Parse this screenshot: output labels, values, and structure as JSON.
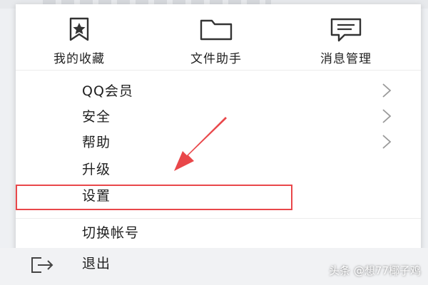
{
  "top_actions": [
    {
      "label": "我的收藏",
      "icon": "bookmark-star-icon"
    },
    {
      "label": "文件助手",
      "icon": "folder-icon"
    },
    {
      "label": "消息管理",
      "icon": "message-bubble-icon"
    }
  ],
  "menu_items": [
    {
      "label": "QQ会员",
      "has_submenu": true
    },
    {
      "label": "安全",
      "has_submenu": true
    },
    {
      "label": "帮助",
      "has_submenu": true
    },
    {
      "label": "升级",
      "has_submenu": false
    },
    {
      "label": "设置",
      "has_submenu": false,
      "highlighted": true
    }
  ],
  "account": {
    "switch_label": "切换帐号"
  },
  "exit": {
    "label": "退出",
    "icon": "exit-icon"
  },
  "annotation": {
    "color": "#e9474a"
  },
  "watermark": "头条 @想77椰子鸡"
}
